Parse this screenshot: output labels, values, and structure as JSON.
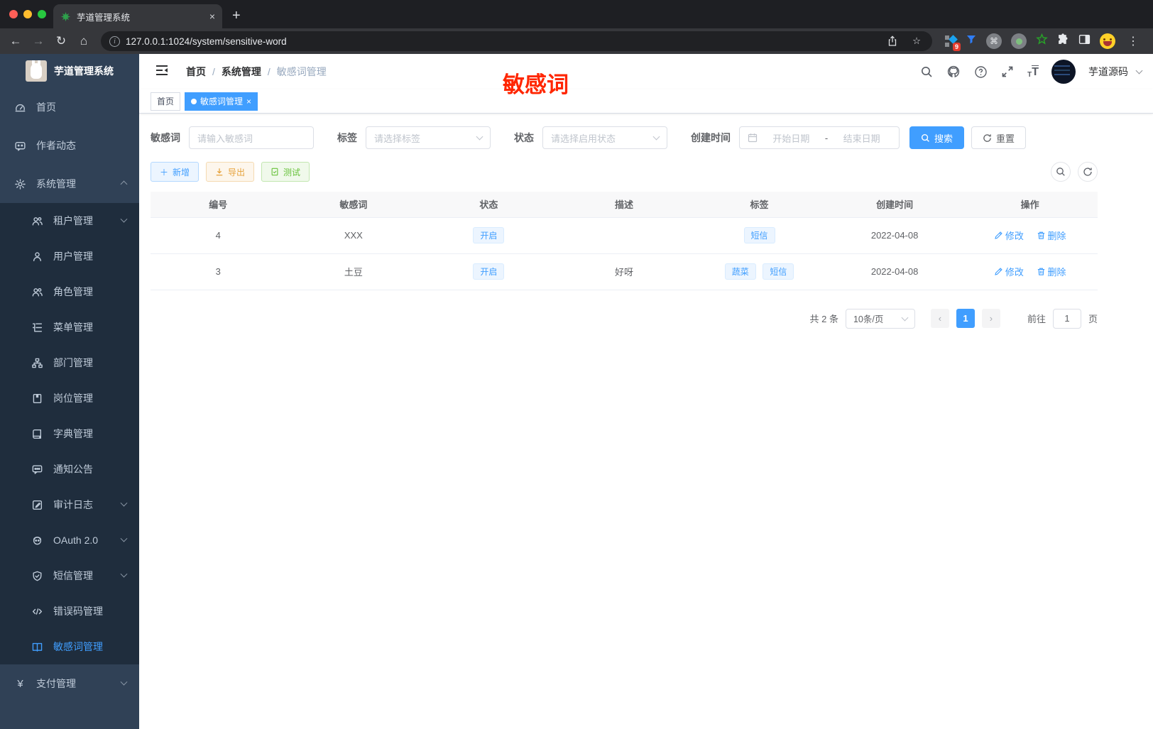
{
  "browser": {
    "tab_title": "芋道管理系统",
    "url": "127.0.0.1:1024/system/sensitive-word",
    "extension_badge": "9",
    "new_tab": "+",
    "close_tab": "×"
  },
  "sidebar": {
    "title": "芋道管理系统",
    "items": [
      {
        "label": "首页"
      },
      {
        "label": "作者动态"
      },
      {
        "label": "系统管理"
      },
      {
        "label": "租户管理"
      },
      {
        "label": "用户管理"
      },
      {
        "label": "角色管理"
      },
      {
        "label": "菜单管理"
      },
      {
        "label": "部门管理"
      },
      {
        "label": "岗位管理"
      },
      {
        "label": "字典管理"
      },
      {
        "label": "通知公告"
      },
      {
        "label": "审计日志"
      },
      {
        "label": "OAuth 2.0"
      },
      {
        "label": "短信管理"
      },
      {
        "label": "错误码管理"
      },
      {
        "label": "敏感词管理"
      },
      {
        "label": "支付管理"
      }
    ]
  },
  "navbar": {
    "breadcrumb": [
      {
        "label": "首页"
      },
      {
        "label": "系统管理"
      },
      {
        "label": "敏感词管理"
      }
    ],
    "separator": "/",
    "user_name": "芋道源码"
  },
  "tags_view": {
    "tabs": [
      {
        "label": "首页"
      },
      {
        "label": "敏感词管理"
      }
    ]
  },
  "annotation": {
    "text": "敏感词",
    "color": "#ff2600"
  },
  "filters": {
    "word_label": "敏感词",
    "word_placeholder": "请输入敏感词",
    "tag_label": "标签",
    "tag_placeholder": "请选择标签",
    "status_label": "状态",
    "status_placeholder": "请选择启用状态",
    "time_label": "创建时间",
    "start_placeholder": "开始日期",
    "range_separator": "-",
    "end_placeholder": "结束日期",
    "search_label": "搜索",
    "reset_label": "重置"
  },
  "toolbar": {
    "add_label": "新增",
    "export_label": "导出",
    "test_label": "测试"
  },
  "table": {
    "columns": [
      "编号",
      "敏感词",
      "状态",
      "描述",
      "标签",
      "创建时间",
      "操作"
    ],
    "rows": [
      {
        "id": "4",
        "word": "XXX",
        "status": "开启",
        "description": "",
        "tags": [
          "短信"
        ],
        "created": "2022-04-08"
      },
      {
        "id": "3",
        "word": "土豆",
        "status": "开启",
        "description": "好呀",
        "tags": [
          "蔬菜",
          "短信"
        ],
        "created": "2022-04-08"
      }
    ],
    "actions": {
      "edit": "修改",
      "delete": "删除"
    }
  },
  "pagination": {
    "total_text": "共 2 条",
    "page_size": "10条/页",
    "current_page": "1",
    "goto_label": "前往",
    "goto_value": "1",
    "unit_label": "页"
  },
  "colors": {
    "primary": "#409eff",
    "warning": "#e6a23c",
    "success": "#67c23a",
    "sidebar_bg": "#304156",
    "submenu_bg": "#1f2d3d"
  }
}
